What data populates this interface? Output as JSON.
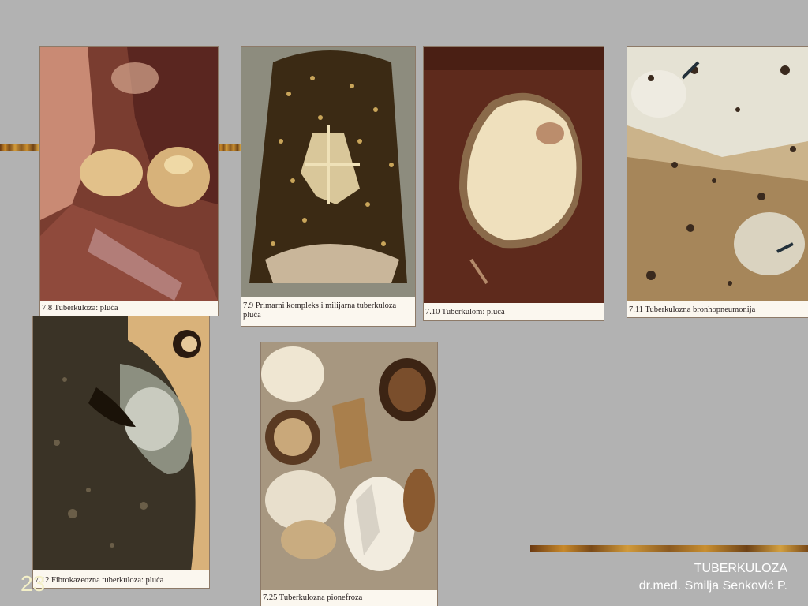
{
  "slide_number": "23",
  "footer": {
    "title": "TUBERKULOZA",
    "author": "dr.med. Smilja Senković P."
  },
  "figures": [
    {
      "caption": "7.8  Tuberkuloza: pluća"
    },
    {
      "caption": "7.9  Primarni kompleks i milijarna tuberkuloza pluća"
    },
    {
      "caption": "7.10  Tuberkulom: pluća"
    },
    {
      "caption": "7.11  Tuberkulozna bronhopneumonija"
    },
    {
      "caption": "7.12  Fibrokazeozna tuberkuloza: pluća"
    },
    {
      "caption": "7.25  Tuberkulozna pionefroza"
    }
  ],
  "colors": {
    "background": "#b2b2b2",
    "slide_number": "#f4f0c8",
    "footer_text": "#ffffff"
  }
}
